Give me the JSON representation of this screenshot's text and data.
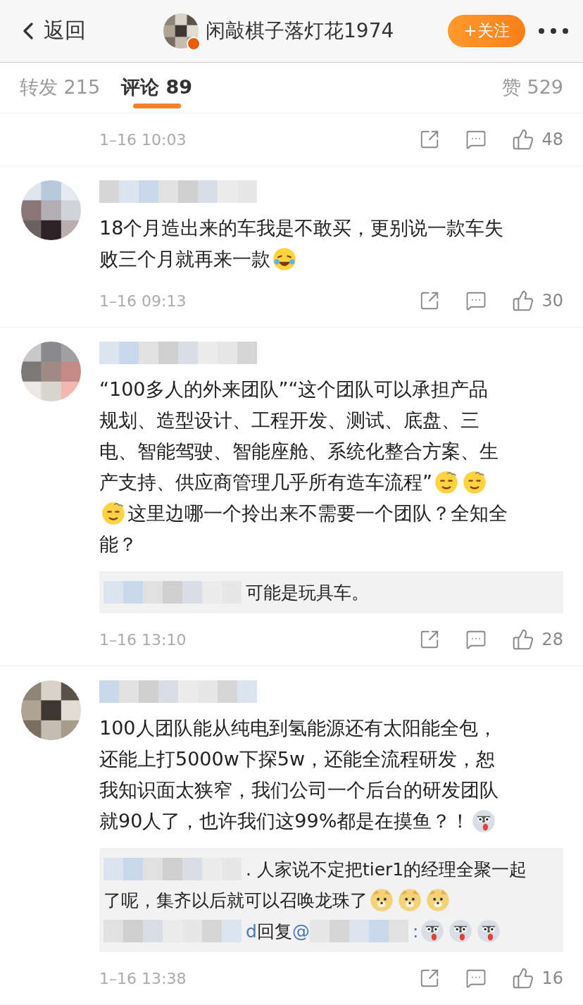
{
  "nav": {
    "back": "返回",
    "title": "闲敲棋子落灯花1974",
    "verified": true,
    "follow": "+关注"
  },
  "tabs": [
    {
      "label": "转发 215",
      "selected": false
    },
    {
      "label": "评论 89",
      "selected": true
    },
    {
      "label": "赞 529",
      "selected": false
    }
  ],
  "comments": [
    {
      "kind": "partial",
      "time": "1–16 10:03",
      "likes": "48"
    },
    {
      "kind": "full",
      "time": "1–16 09:13",
      "likes": "30",
      "lines": [
        [
          {
            "kind": "text",
            "text": "18个月造出来的车我是不敢买，更别说一款车失"
          }
        ],
        [
          {
            "kind": "text",
            "text": "败三个月就再来一款"
          },
          {
            "kind": "emoji_laugh"
          }
        ]
      ]
    },
    {
      "kind": "full",
      "time": "1–16 13:10",
      "likes": "28",
      "lines": [
        [
          {
            "kind": "text",
            "text": "“100多人的外来团队”“这个团队可以承担产品"
          }
        ],
        [
          {
            "kind": "text",
            "text": "规划、造型设计、工程开发、测试、底盘、三"
          }
        ],
        [
          {
            "kind": "text",
            "text": "电、智能驾驶、智能座舱、系统化整合方案、生"
          }
        ],
        [
          {
            "kind": "text",
            "text": "产支持、供应商管理几乎所有造车流程”"
          },
          {
            "kind": "emoji_dizzy"
          },
          {
            "kind": "emoji_dizzy"
          }
        ],
        [
          {
            "kind": "emoji_dizzy"
          },
          {
            "kind": "text",
            "text": "这里边哪一个拎出来不需要一个团队？全知全"
          }
        ],
        [
          {
            "kind": "text",
            "text": "能？"
          }
        ]
      ],
      "replies": [
        [
          {
            "kind": "blur"
          },
          {
            "kind": "text",
            "text": "可能是玩具车。"
          }
        ]
      ]
    },
    {
      "kind": "full",
      "time": "1–16 13:38",
      "likes": "16",
      "lines": [
        [
          {
            "kind": "text",
            "text": "100人团队能从纯电到氢能源还有太阳能全包，"
          }
        ],
        [
          {
            "kind": "text",
            "text": "还能上打5000w下探5w，还能全流程研发，恕"
          }
        ],
        [
          {
            "kind": "text",
            "text": "我知识面太狭窄，我们公司一个后台的研发团队"
          }
        ],
        [
          {
            "kind": "text",
            "text": "就90人了，也许我们这99%都是在摸鱼？！"
          },
          {
            "kind": "emoji_husky"
          }
        ]
      ],
      "replies": [
        [
          {
            "kind": "blur"
          },
          {
            "kind": "text",
            "text": ". 人家说不定把tier1的经理全聚一起"
          }
        ],
        [
          {
            "kind": "text",
            "text": "了呢，集齐以后就可以召唤龙珠了"
          },
          {
            "kind": "emoji_doge"
          },
          {
            "kind": "emoji_doge"
          },
          {
            "kind": "emoji_doge"
          }
        ],
        [
          {
            "kind": "blur"
          },
          {
            "kind": "link",
            "text": "d"
          },
          {
            "kind": "text",
            "text": "回复"
          },
          {
            "kind": "link",
            "text": "@"
          },
          {
            "kind": "blur"
          },
          {
            "kind": "link",
            "text": ":"
          },
          {
            "kind": "emoji_husky"
          },
          {
            "kind": "emoji_husky"
          },
          {
            "kind": "emoji_husky"
          }
        ]
      ]
    }
  ]
}
